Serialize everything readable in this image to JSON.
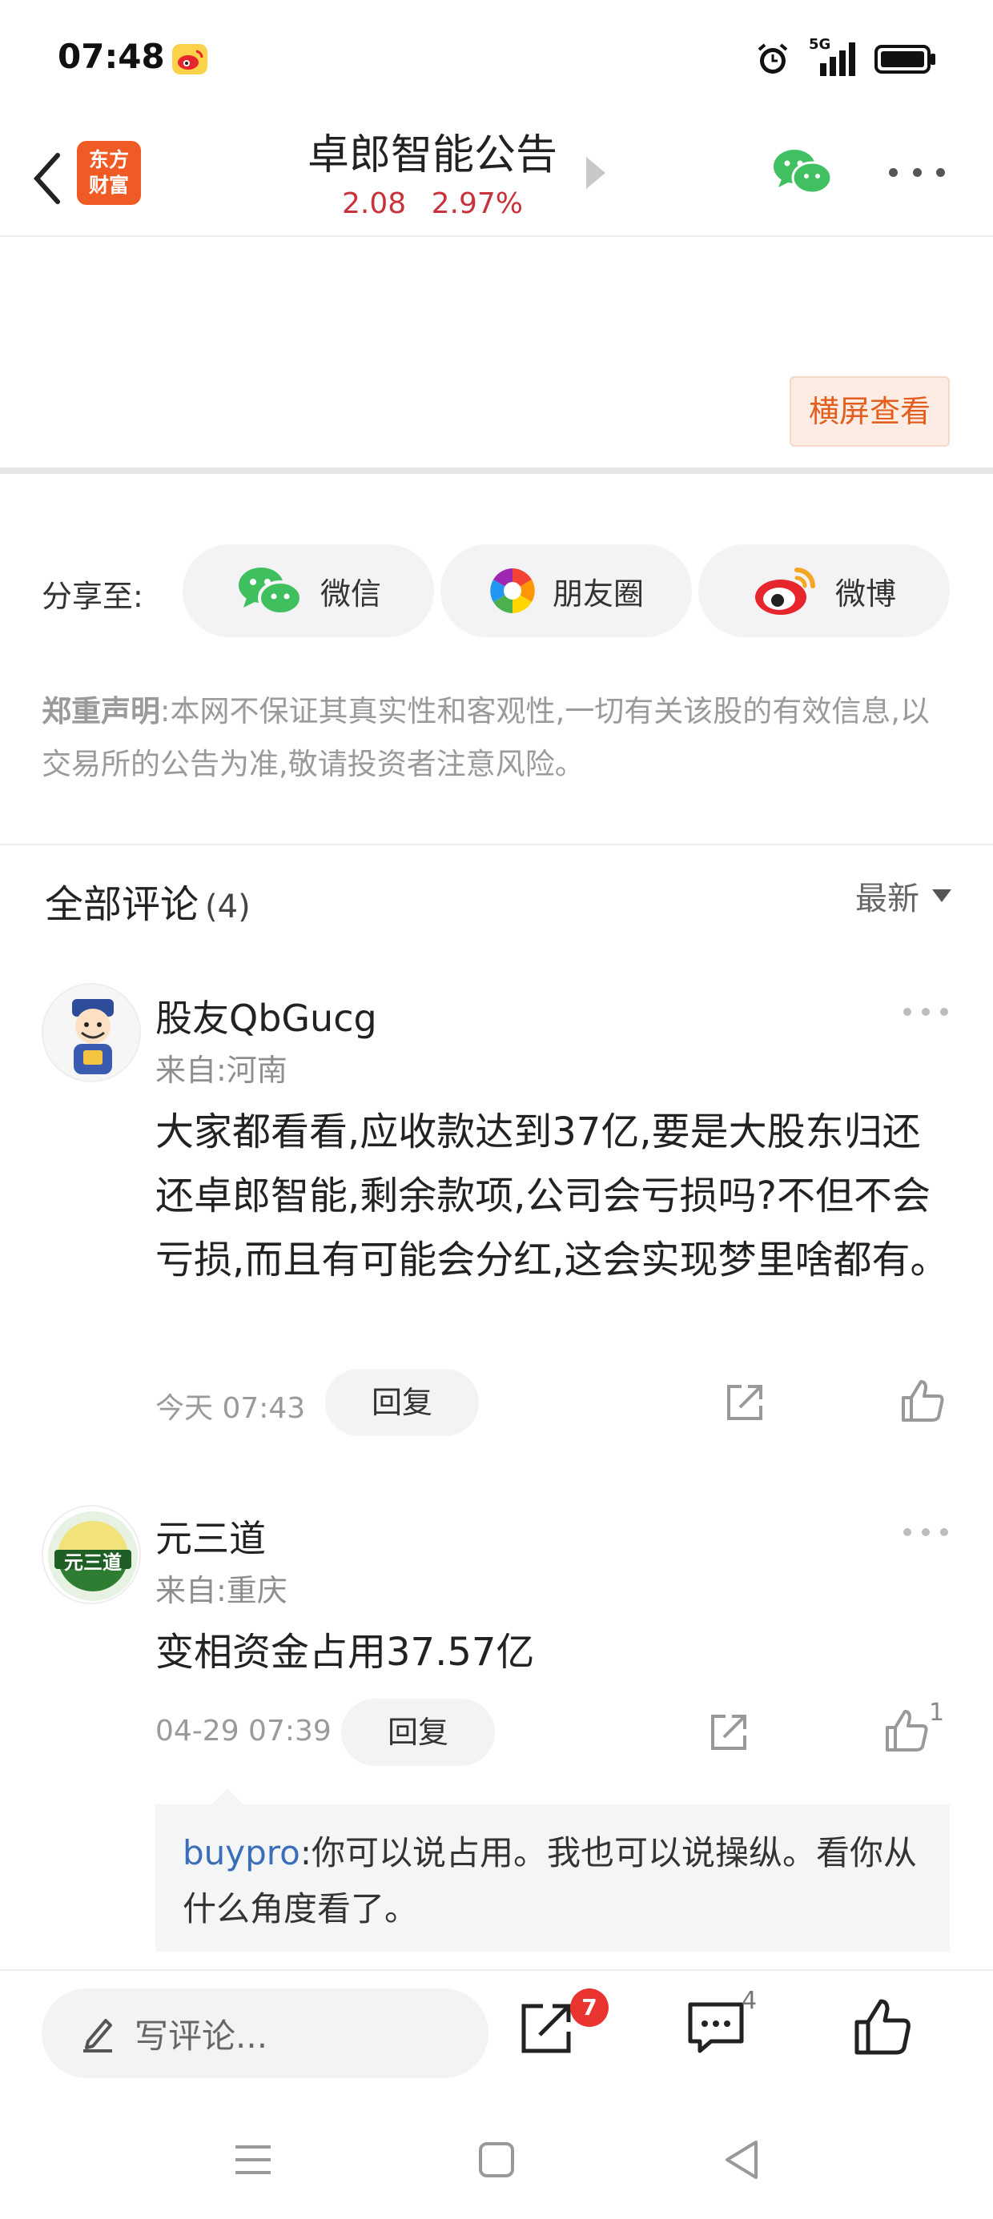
{
  "status_bar": {
    "time": "07:48",
    "signal_label": "5G",
    "icons": [
      "weibo-notification-icon",
      "alarm-icon",
      "signal-5g-icon",
      "battery-icon"
    ]
  },
  "header": {
    "logo_line1": "东方",
    "logo_line2": "财富",
    "title": "卓郎智能公告",
    "price": "2.08",
    "change_pct": "2.97%",
    "quote_color": "#c8323c",
    "icons": [
      "back-arrow-icon",
      "play-arrow-icon",
      "wechat-icon",
      "more-icon"
    ]
  },
  "content": {
    "landscape_button": "横屏查看"
  },
  "share": {
    "label": "分享至:",
    "options": [
      {
        "label": "微信",
        "icon": "wechat-icon"
      },
      {
        "label": "朋友圈",
        "icon": "moments-icon"
      },
      {
        "label": "微博",
        "icon": "weibo-icon"
      }
    ]
  },
  "disclaimer": {
    "title": "郑重声明",
    "text": ":本网不保证其真实性和客观性,一切有关该股的有效信息,以交易所的公告为准,敬请投资者注意风险。"
  },
  "comments": {
    "title": "全部评论",
    "count": "(4)",
    "sort_label": "最新",
    "items": [
      {
        "user": "股友QbGucg",
        "location": "来自:河南",
        "text": "大家都看看,应收款达到37亿,要是大股东归还还卓郎智能,剩余款项,公司会亏损吗?不但不会亏损,而且有可能会分红,这会实现梦里啥都有。",
        "time": "今天 07:43",
        "reply_label": "回复",
        "likes": ""
      },
      {
        "user": "元三道",
        "avatar_text": "元三道",
        "location": "来自:重庆",
        "text": "变相资金占用37.57亿",
        "time": "04-29 07:39",
        "reply_label": "回复",
        "likes": "1",
        "sub_reply": {
          "user": "buypro",
          "text": ":你可以说占用。我也可以说操纵。看你从什么角度看了。"
        }
      }
    ]
  },
  "bottom_bar": {
    "write_placeholder": "写评论...",
    "share_badge": "7",
    "comment_count": "4"
  },
  "colors": {
    "accent_orange": "#f05a24",
    "link_blue": "#3a6fb8",
    "badge_red": "#e9342f"
  }
}
